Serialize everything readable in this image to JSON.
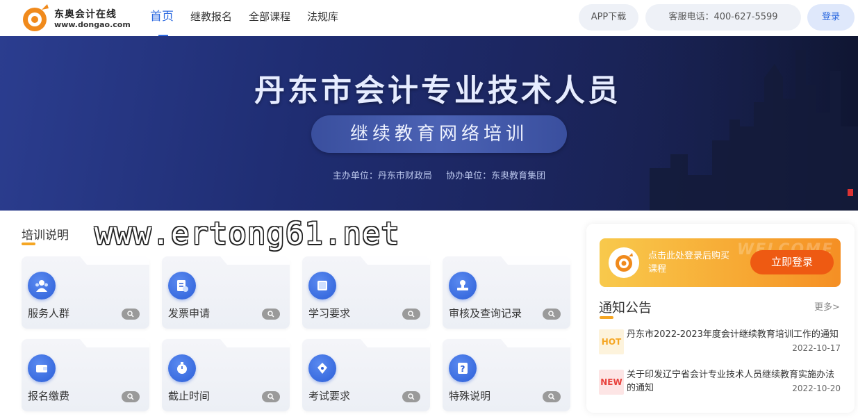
{
  "header": {
    "logo_title": "东奥会计在线",
    "logo_url": "www.dongao.com",
    "nav": [
      "首页",
      "继教报名",
      "全部课程",
      "法规库"
    ],
    "app_download": "APP下载",
    "phone": "客服电话：400-627-5599",
    "login": "登录"
  },
  "banner": {
    "title": "丹东市会计专业技术人员",
    "subtitle": "继续教育网络培训",
    "host": "主办单位：丹东市财政局",
    "co_host": "协办单位：东奥教育集团"
  },
  "training": {
    "title": "培训说明",
    "watermark": "www.ertong61.net",
    "cards": [
      {
        "label": "服务人群",
        "icon": "users-icon"
      },
      {
        "label": "发票申请",
        "icon": "invoice-icon"
      },
      {
        "label": "学习要求",
        "icon": "book-icon"
      },
      {
        "label": "审核及查询记录",
        "icon": "stamp-icon"
      },
      {
        "label": "报名缴费",
        "icon": "wallet-icon"
      },
      {
        "label": "截止时间",
        "icon": "stopwatch-icon"
      },
      {
        "label": "考试要求",
        "icon": "pen-nib-icon"
      },
      {
        "label": "特殊说明",
        "icon": "question-doc-icon"
      }
    ]
  },
  "side": {
    "welcome": "WELCOME",
    "login_prompt": "点击此处登录后购买课程",
    "login_button": "立即登录",
    "notice_title": "通知公告",
    "more": "更多>",
    "notices": [
      {
        "badge": "HOT",
        "text": "丹东市2022-2023年度会计继续教育培训工作的通知",
        "date": "2022-10-17"
      },
      {
        "badge": "NEW",
        "text": "关于印发辽宁省会计专业技术人员继续教育实施办法的通知",
        "date": "2022-10-20"
      }
    ]
  },
  "colors": {
    "accent": "#2d6ae0",
    "orange": "#f5a623",
    "login_button": "#ee5a12",
    "banner_bg": "#1f2d72"
  }
}
